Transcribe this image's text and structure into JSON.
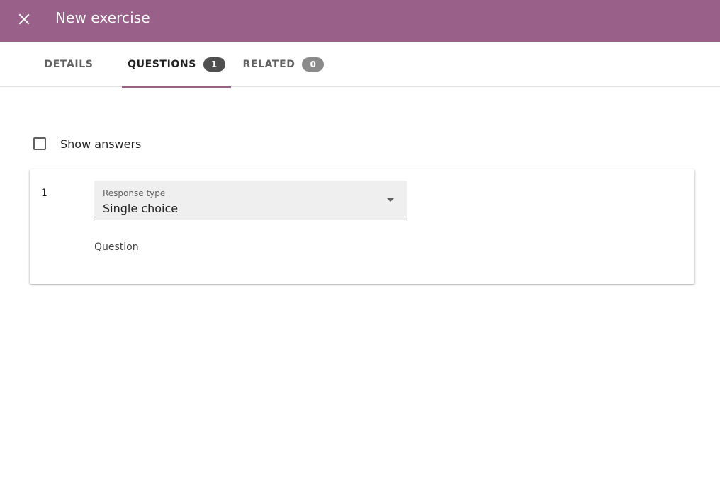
{
  "appbar": {
    "title": "New exercise",
    "close_icon": "close-icon",
    "color": "#996189"
  },
  "tabs": [
    {
      "label": "DETAILS",
      "badge": null,
      "active": false
    },
    {
      "label": "QUESTIONS",
      "badge": "1",
      "active": true
    },
    {
      "label": "RELATED",
      "badge": "0",
      "active": false
    }
  ],
  "show_answers": {
    "label": "Show answers",
    "checked": false
  },
  "question_card": {
    "number": "1",
    "response_type": {
      "label": "Response type",
      "value": "Single choice",
      "icon": "dropdown-arrow-icon"
    },
    "question_label": "Question"
  }
}
